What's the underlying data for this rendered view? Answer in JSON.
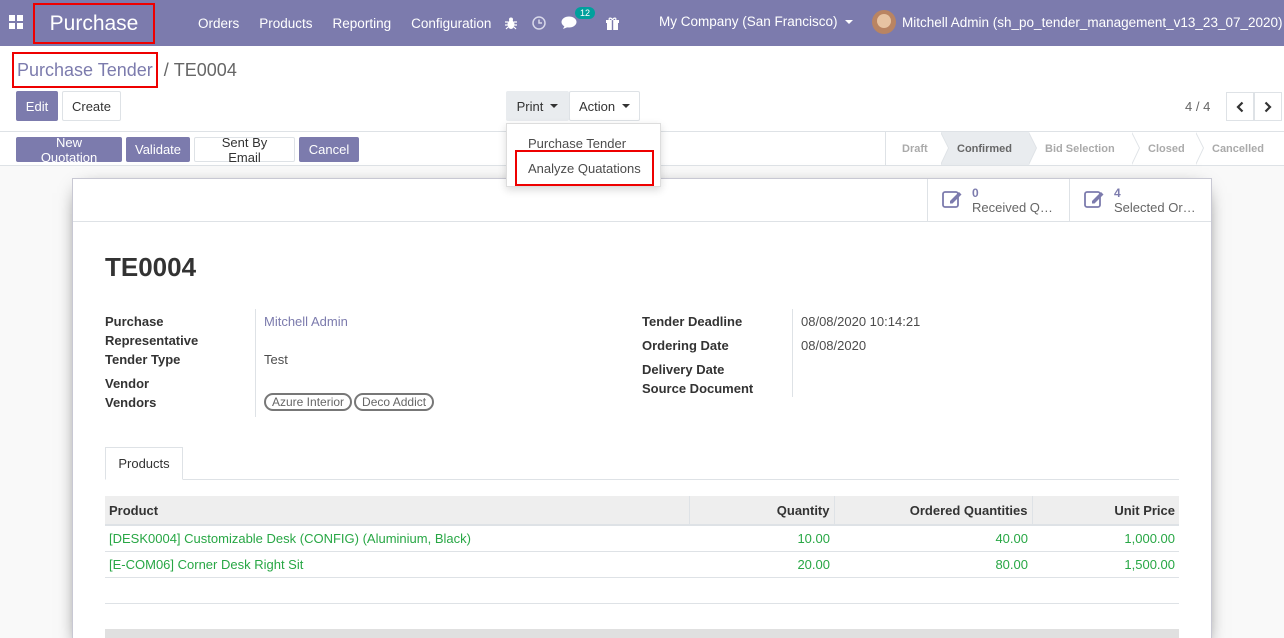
{
  "navbar": {
    "brand": "Purchase",
    "menu": [
      "Orders",
      "Products",
      "Reporting",
      "Configuration"
    ],
    "chat_count": "12",
    "company": "My Company (San Francisco)",
    "user": "Mitchell Admin (sh_po_tender_management_v13_23_07_2020)",
    "icons": [
      "apps-icon",
      "bug-icon",
      "clock-icon",
      "chat-icon",
      "gift-icon"
    ]
  },
  "breadcrumb": {
    "parent": "Purchase Tender",
    "separator": "/",
    "current": "TE0004"
  },
  "controls": {
    "edit": "Edit",
    "create": "Create",
    "print": "Print",
    "action": "Action",
    "pager": "4 / 4"
  },
  "print_menu": {
    "items": [
      "Purchase Tender",
      "Analyze Quatations"
    ]
  },
  "statusbar": {
    "buttons": [
      "New Quotation",
      "Validate",
      "Sent By Email",
      "Cancel"
    ],
    "stages": [
      "Draft",
      "Confirmed",
      "Bid Selection",
      "Closed",
      "Cancelled"
    ],
    "active_stage": "Confirmed"
  },
  "stat_buttons": [
    {
      "value": "0",
      "label": "Received Quotations"
    },
    {
      "value": "4",
      "label": "Selected Orders"
    }
  ],
  "record": {
    "name": "TE0004",
    "left_fields": [
      {
        "label": "Purchase Representative",
        "value": "Mitchell Admin"
      },
      {
        "label": "Tender Type",
        "value": "Test"
      },
      {
        "label": "Vendor",
        "value": ""
      },
      {
        "label": "Vendors",
        "value": ""
      }
    ],
    "vendor_tags": [
      "Azure Interior",
      "Deco Addict"
    ],
    "right_fields": [
      {
        "label": "Tender Deadline",
        "value": "08/08/2020 10:14:21"
      },
      {
        "label": "Ordering Date",
        "value": "08/08/2020"
      },
      {
        "label": "Delivery Date",
        "value": ""
      },
      {
        "label": "Source Document",
        "value": ""
      }
    ]
  },
  "tabs": [
    "Products"
  ],
  "lines_table": {
    "columns": [
      "Product",
      "Quantity",
      "Ordered Quantities",
      "Unit Price"
    ],
    "rows": [
      [
        "[DESK0004] Customizable Desk (CONFIG) (Aluminium, Black)",
        "10.00",
        "40.00",
        "1,000.00"
      ],
      [
        "[E-COM06] Corner Desk Right Sit",
        "20.00",
        "80.00",
        "1,500.00"
      ]
    ]
  },
  "colors": {
    "brand": "#7c7bad",
    "highlight_box": "#ee0000",
    "line_text": "#28a745",
    "badge": "#00a09d"
  }
}
